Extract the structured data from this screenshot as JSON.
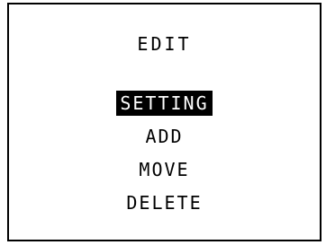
{
  "menu": {
    "title": "EDIT",
    "items": [
      {
        "label": "SETTING",
        "selected": true
      },
      {
        "label": "ADD",
        "selected": false
      },
      {
        "label": "MOVE",
        "selected": false
      },
      {
        "label": "DELETE",
        "selected": false
      }
    ]
  },
  "colors": {
    "background": "#ffffff",
    "foreground": "#000000",
    "highlight_background": "#000000",
    "highlight_foreground": "#ffffff"
  }
}
